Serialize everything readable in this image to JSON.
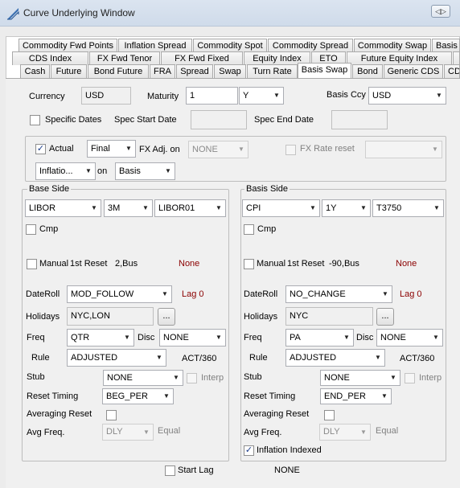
{
  "window": {
    "title": "Curve Underlying Window",
    "restore_glyph": "◁▷"
  },
  "tabs": {
    "row1": [
      "Commodity Fwd Points",
      "Inflation Spread",
      "Commodity Spot",
      "Commodity Spread",
      "Commodity Swap",
      "Basis"
    ],
    "row2": [
      "CDS Index",
      "FX Fwd Tenor",
      "FX Fwd Fixed",
      "Equity Index",
      "ETO",
      "Future Equity Index"
    ],
    "row3": [
      "Cash",
      "Future",
      "Bond Future",
      "FRA",
      "Spread",
      "Swap",
      "Turn Rate",
      "Basis Swap",
      "Bond",
      "Generic CDS",
      "CD"
    ],
    "active": "Basis Swap"
  },
  "top": {
    "currency_label": "Currency",
    "currency_value": "USD",
    "maturity_label": "Maturity",
    "maturity_value": "1",
    "maturity_unit": "Y",
    "basis_ccy_label": "Basis Ccy",
    "basis_ccy_value": "USD",
    "specific_dates_label": "Specific Dates",
    "spec_start_label": "Spec Start Date",
    "spec_start_value": "",
    "spec_end_label": "Spec End Date",
    "spec_end_value": ""
  },
  "options": {
    "actual_label": "Actual",
    "actual_checked": true,
    "final_value": "Final",
    "fx_adj_label": "FX Adj. on",
    "fx_adj_value": "NONE",
    "fx_rate_reset_label": "FX Rate reset",
    "fx_rate_reset_value": "",
    "inflation_value": "Inflatio...",
    "on_label": "on",
    "basis_value": "Basis"
  },
  "base": {
    "title": "Base Side",
    "index": "LIBOR",
    "tenor": "3M",
    "curve": "LIBOR01",
    "cmp_label": "Cmp",
    "manual_label": "Manual",
    "first_reset_label": "1st Reset",
    "first_reset_value": "2,Bus",
    "first_reset_status": "None",
    "dateroll_label": "DateRoll",
    "dateroll_value": "MOD_FOLLOW",
    "lag_label": "Lag 0",
    "holidays_label": "Holidays",
    "holidays_value": "NYC,LON",
    "ellipsis": "...",
    "freq_label": "Freq",
    "freq_value": "QTR",
    "disc_label": "Disc",
    "disc_value": "NONE",
    "rule_label": "Rule",
    "rule_value": "ADJUSTED",
    "daycount": "ACT/360",
    "stub_label": "Stub",
    "stub_value": "NONE",
    "interp_label": "Interp",
    "reset_timing_label": "Reset Timing",
    "reset_timing_value": "BEG_PER",
    "averaging_reset_label": "Averaging Reset",
    "avg_freq_label": "Avg Freq.",
    "avg_freq_value": "DLY",
    "equal_label": "Equal"
  },
  "basis": {
    "title": "Basis Side",
    "index": "CPI",
    "tenor": "1Y",
    "curve": "T3750",
    "cmp_label": "Cmp",
    "manual_label": "Manual",
    "first_reset_label": "1st Reset",
    "first_reset_value": "-90,Bus",
    "first_reset_status": "None",
    "dateroll_label": "DateRoll",
    "dateroll_value": "NO_CHANGE",
    "lag_label": "Lag 0",
    "holidays_label": "Holidays",
    "holidays_value": "NYC",
    "ellipsis": "...",
    "freq_label": "Freq",
    "freq_value": "PA",
    "disc_label": "Disc",
    "disc_value": "NONE",
    "rule_label": "Rule",
    "rule_value": "ADJUSTED",
    "daycount": "ACT/360",
    "stub_label": "Stub",
    "stub_value": "NONE",
    "interp_label": "Interp",
    "reset_timing_label": "Reset Timing",
    "reset_timing_value": "END_PER",
    "averaging_reset_label": "Averaging Reset",
    "avg_freq_label": "Avg Freq.",
    "avg_freq_value": "DLY",
    "equal_label": "Equal",
    "inflation_indexed_label": "Inflation Indexed",
    "inflation_indexed_checked": true
  },
  "bottom": {
    "start_lag_label": "Start Lag",
    "start_lag_value": "NONE"
  },
  "icons": {
    "check": "✓",
    "dropdown": "▼"
  }
}
